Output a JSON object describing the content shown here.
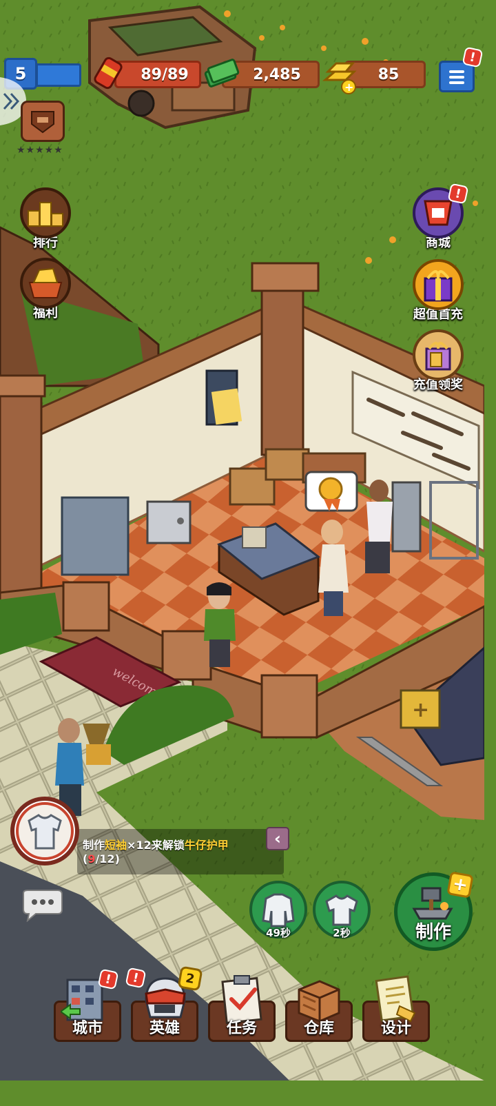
{
  "hud": {
    "level": "5",
    "energy": "89/89",
    "cash": "2,485",
    "gold": "85",
    "player_rating_stars": 5
  },
  "left_menu": {
    "ranking_label": "排行",
    "welfare_label": "福利"
  },
  "right_menu": {
    "shop_label": "商城",
    "first_recharge_label": "超值首充",
    "recharge_reward_label": "充值领奖"
  },
  "scene": {
    "doormat_text": "welcome"
  },
  "craft_goal": {
    "prefix": "制作",
    "item": "短袖",
    "count_text": "×12来解锁",
    "reward": "牛仔护甲",
    "progress_open": "(",
    "progress_current": "9",
    "progress_total": "/12)",
    "collapse_glyph": "‹"
  },
  "queue": [
    {
      "timer": "49秒",
      "icon": "jacket-icon"
    },
    {
      "timer": "2秒",
      "icon": "tshirt-icon"
    }
  ],
  "craft_button": {
    "label": "制作",
    "plus": "+"
  },
  "bottom_nav": {
    "city": "城市",
    "heroes": "英雄",
    "heroes_badge": "2",
    "tasks": "任务",
    "warehouse": "仓库",
    "design": "设计"
  },
  "alerts": {
    "glyph": "!"
  },
  "colors": {
    "grass": "#5f8d2c",
    "floor_tile_a": "#c9612f",
    "floor_tile_b": "#e0905c",
    "wall": "#ede6cf",
    "wood": "#9a5a36",
    "button_green": "#2a8f43",
    "hud_blue": "#2c6ec9",
    "alert_red": "#e33a2c"
  }
}
